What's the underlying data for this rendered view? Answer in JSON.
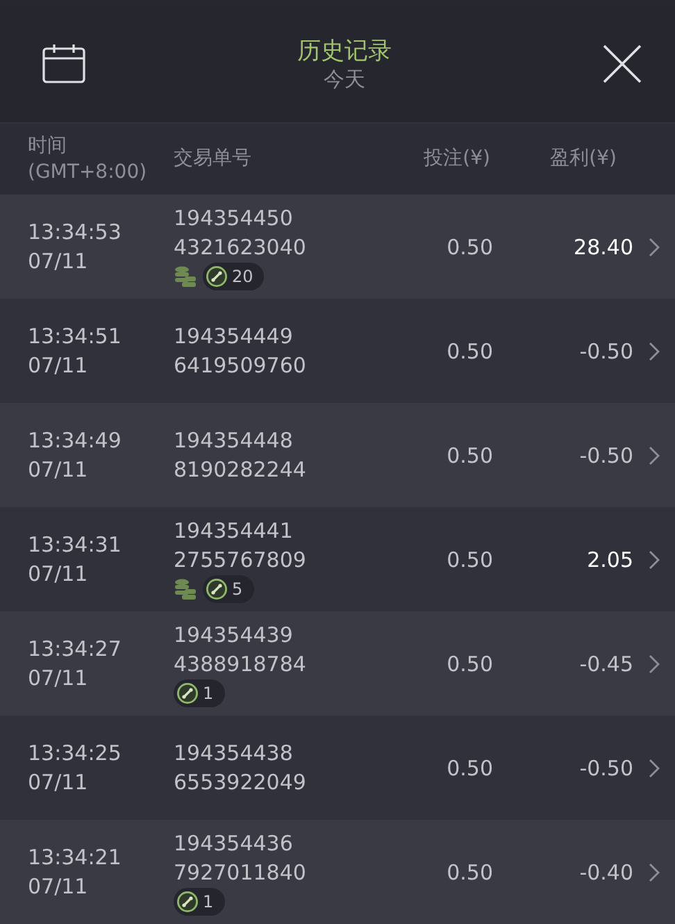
{
  "header": {
    "title": "历史记录",
    "subtitle": "今天"
  },
  "columns": [
    {
      "label": "时间\n(GMT+8:00)"
    },
    {
      "label": "交易单号"
    },
    {
      "label": "投注(¥)"
    },
    {
      "label": "盈利(¥)"
    }
  ],
  "rows": [
    {
      "time": "13:34:53",
      "date": "07/11",
      "order": [
        "194354450",
        "4321623040"
      ],
      "coins": true,
      "badge": "20",
      "stake": "0.50",
      "profit": "28.40",
      "win": true
    },
    {
      "time": "13:34:51",
      "date": "07/11",
      "order": [
        "194354449",
        "6419509760"
      ],
      "coins": false,
      "stake": "0.50",
      "profit": "-0.50",
      "win": false
    },
    {
      "time": "13:34:49",
      "date": "07/11",
      "order": [
        "194354448",
        "8190282244"
      ],
      "coins": false,
      "stake": "0.50",
      "profit": "-0.50",
      "win": false
    },
    {
      "time": "13:34:31",
      "date": "07/11",
      "order": [
        "194354441",
        "2755767809"
      ],
      "coins": true,
      "badge": "5",
      "stake": "0.50",
      "profit": "2.05",
      "win": true
    },
    {
      "time": "13:34:27",
      "date": "07/11",
      "order": [
        "194354439",
        "4388918784"
      ],
      "coins": false,
      "badge": "1",
      "stake": "0.50",
      "profit": "-0.45",
      "win": false
    },
    {
      "time": "13:34:25",
      "date": "07/11",
      "order": [
        "194354438",
        "6553922049"
      ],
      "coins": false,
      "stake": "0.50",
      "profit": "-0.50",
      "win": false
    },
    {
      "time": "13:34:21",
      "date": "07/11",
      "order": [
        "194354436",
        "7927011840"
      ],
      "coins": false,
      "badge": "1",
      "stake": "0.50",
      "profit": "-0.40",
      "win": false
    }
  ]
}
